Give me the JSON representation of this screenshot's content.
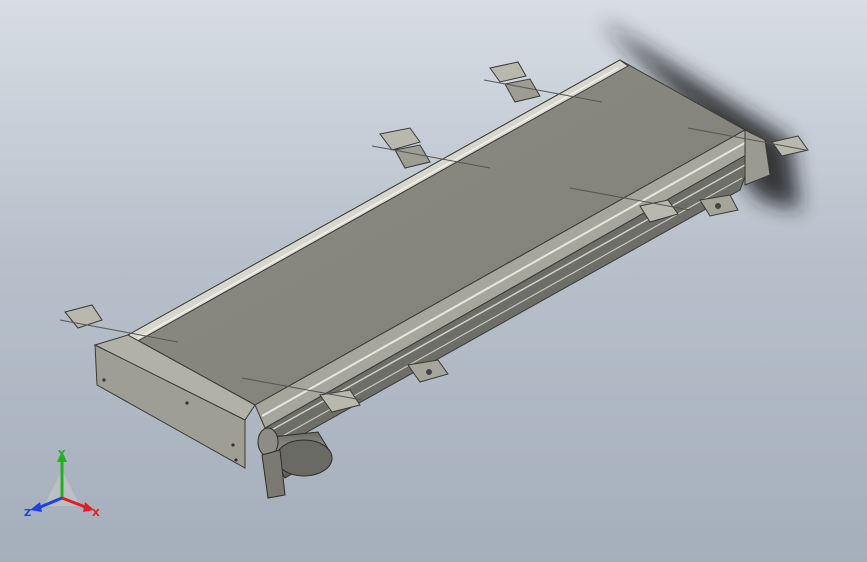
{
  "viewport": {
    "background_top": "#d8dde4",
    "background_bottom": "#a5afbb",
    "model_color": "#8a8a80",
    "model_dark": "#5e5e58",
    "frame_color": "#b9b9b0"
  },
  "model": {
    "type": "belt-conveyor-assembly",
    "icons": [
      "conveyor-belt",
      "motor",
      "mounting-bracket",
      "support-foot"
    ]
  },
  "triad": {
    "x_label": "X",
    "y_label": "Y",
    "z_label": "Z",
    "x_color": "#e02020",
    "y_color": "#20b020",
    "z_color": "#2040e0"
  }
}
